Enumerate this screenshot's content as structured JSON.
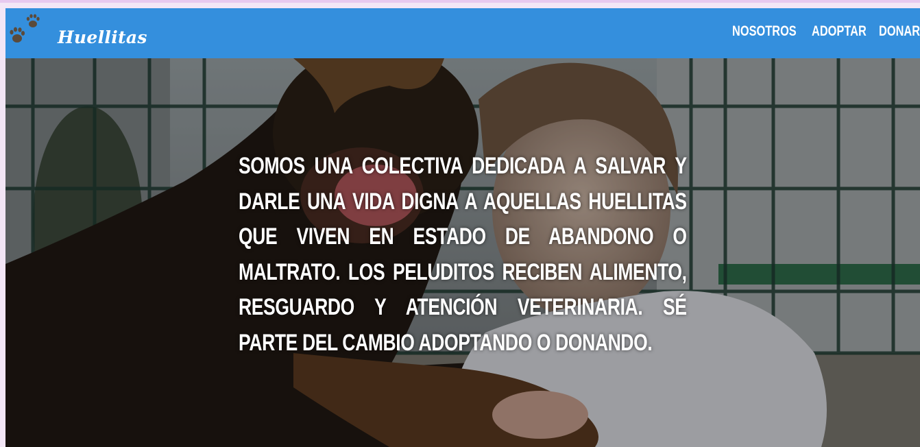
{
  "navbar": {
    "brand": "Huellitas",
    "logo_icon": "paw-prints-icon",
    "links": [
      "NOSOTROS",
      "ADOPTAR",
      "DONAR"
    ],
    "background_color": "#348fdd"
  },
  "hero": {
    "text": "SOMOS UNA COLECTIVA DEDICADA A SALVAR Y DARLE UNA VIDA DIGNA A AQUELLAS HUELLITAS QUE VIVEN EN ESTADO DE ABANDONO O MALTRATO. LOS PELUDITOS RECIBEN ALIMENTO, RESGUARDO Y ATENCIÓN VETERINARIA. SÉ PARTE DEL CAMBIO ADOPTANDO O DONANDO."
  }
}
